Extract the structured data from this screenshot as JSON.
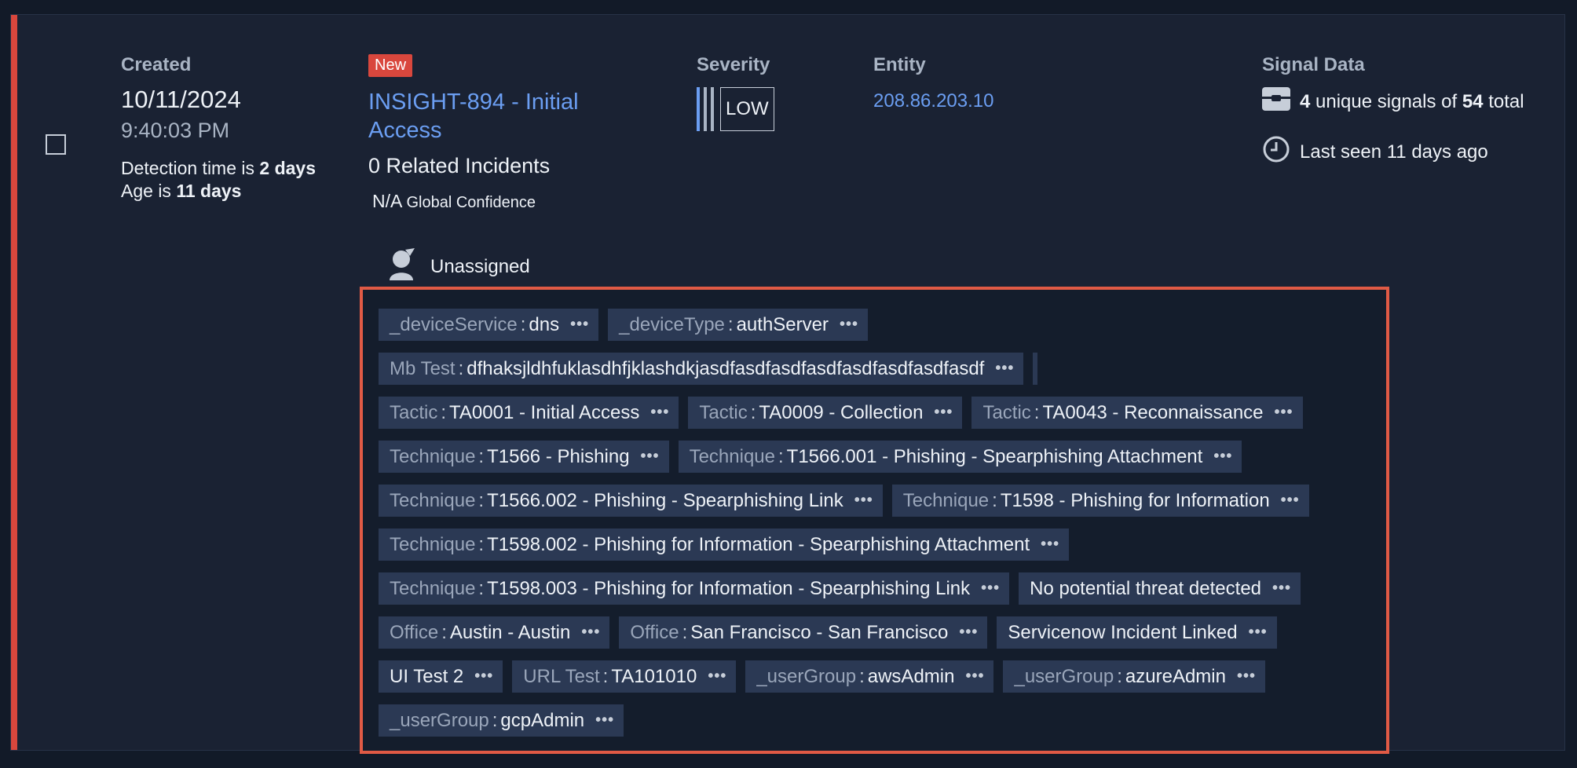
{
  "colors": {
    "accent_red": "#d9473d",
    "link_blue": "#6b9ef2",
    "tag_bg": "#2b3954",
    "highlight_border": "#e05a45"
  },
  "created": {
    "label": "Created",
    "date": "10/11/2024",
    "time": "9:40:03 PM",
    "detection_prefix": "Detection time is ",
    "detection_value": "2 days",
    "age_prefix": "Age is ",
    "age_value": "11 days"
  },
  "insight": {
    "badge": "New",
    "title": "INSIGHT-894 - Initial Access",
    "related": "0 Related Incidents",
    "confidence_value": "N/A",
    "confidence_label": "Global Confidence"
  },
  "assignee": {
    "icon": "user-unassigned-icon",
    "name": "Unassigned"
  },
  "severity": {
    "label": "Severity",
    "level": "LOW"
  },
  "entity": {
    "label": "Entity",
    "value": "208.86.203.10"
  },
  "signal_data": {
    "label": "Signal Data",
    "unique": "4",
    "unique_text": " unique signals of ",
    "total": "54",
    "total_text": " total",
    "last_seen": "Last seen 11 days ago"
  },
  "tags": [
    [
      {
        "k": "_deviceService",
        "v": "dns"
      },
      {
        "k": "_deviceType",
        "v": "authServer"
      }
    ],
    [
      {
        "k": "Mb Test",
        "v": "dfhaksjldhfuklasdhfjklashdkjasdfasdfasdfasdfasdfasdfasdfasdf"
      }
    ],
    [
      {
        "k": "Tactic",
        "v": "TA0001 - Initial Access"
      },
      {
        "k": "Tactic",
        "v": "TA0009 - Collection"
      },
      {
        "k": "Tactic",
        "v": "TA0043 - Reconnaissance"
      }
    ],
    [
      {
        "k": "Technique",
        "v": "T1566 - Phishing"
      },
      {
        "k": "Technique",
        "v": "T1566.001 - Phishing - Spearphishing Attachment"
      }
    ],
    [
      {
        "k": "Technique",
        "v": "T1566.002 - Phishing - Spearphishing Link"
      },
      {
        "k": "Technique",
        "v": "T1598 - Phishing for Information"
      }
    ],
    [
      {
        "k": "Technique",
        "v": "T1598.002 - Phishing for Information - Spearphishing Attachment"
      }
    ],
    [
      {
        "k": "Technique",
        "v": "T1598.003 - Phishing for Information - Spearphishing Link"
      },
      {
        "k": "",
        "v": "No potential threat detected"
      }
    ],
    [
      {
        "k": "Office",
        "v": "Austin - Austin"
      },
      {
        "k": "Office",
        "v": "San Francisco - San Francisco"
      },
      {
        "k": "",
        "v": "Servicenow Incident Linked"
      }
    ],
    [
      {
        "k": "",
        "v": "UI Test 2"
      },
      {
        "k": "URL Test",
        "v": "TA101010"
      },
      {
        "k": "_userGroup",
        "v": "awsAdmin"
      },
      {
        "k": "_userGroup",
        "v": "azureAdmin"
      }
    ],
    [
      {
        "k": "_userGroup",
        "v": "gcpAdmin"
      }
    ]
  ],
  "more_glyph": "•••"
}
